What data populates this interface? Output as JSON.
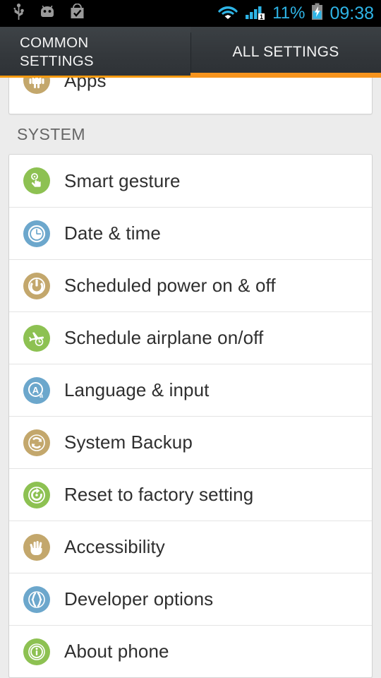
{
  "statusbar": {
    "left_icons": [
      "usb-icon",
      "android-debug-icon",
      "play-store-icon"
    ],
    "wifi_icon": "wifi-icon",
    "signal_icon": "signal-bars-icon",
    "sim_badge": "1",
    "battery_percent": "11%",
    "battery_icon": "battery-charging-icon",
    "time": "09:38",
    "accent_color": "#2eb4e6"
  },
  "tabs": {
    "common_label": "COMMON\nSETTINGS",
    "all_label": "ALL SETTINGS",
    "active": "ALL SETTINGS",
    "underline_color": "#f7941d"
  },
  "top_card": {
    "rows": [
      {
        "label": "Apps",
        "icon": "android-robot-icon",
        "icon_color": "tan"
      }
    ]
  },
  "section": {
    "header": "SYSTEM",
    "rows": [
      {
        "label": "Smart gesture",
        "icon": "hand-touch-icon",
        "icon_color": "green"
      },
      {
        "label": "Date & time",
        "icon": "clock-icon",
        "icon_color": "blue"
      },
      {
        "label": "Scheduled power on & off",
        "icon": "power-icon",
        "icon_color": "tan"
      },
      {
        "label": "Schedule airplane on/off",
        "icon": "airplane-icon",
        "icon_color": "green"
      },
      {
        "label": "Language & input",
        "icon": "letter-a-icon",
        "icon_color": "blue"
      },
      {
        "label": "System Backup",
        "icon": "refresh-sync-icon",
        "icon_color": "tan"
      },
      {
        "label": "Reset to factory setting",
        "icon": "reset-arrow-icon",
        "icon_color": "green"
      },
      {
        "label": "Accessibility",
        "icon": "open-hand-icon",
        "icon_color": "tan"
      },
      {
        "label": "Developer options",
        "icon": "curly-braces-icon",
        "icon_color": "blue"
      },
      {
        "label": "About phone",
        "icon": "info-icon",
        "icon_color": "green"
      }
    ]
  },
  "colors": {
    "page_background": "#ececec",
    "card_background": "#ffffff",
    "text_primary": "#2f2f2f",
    "text_secondary": "#666666",
    "icon_green": "#8dc152",
    "icon_blue": "#6ca7cc",
    "icon_tan": "#c3a76c"
  }
}
